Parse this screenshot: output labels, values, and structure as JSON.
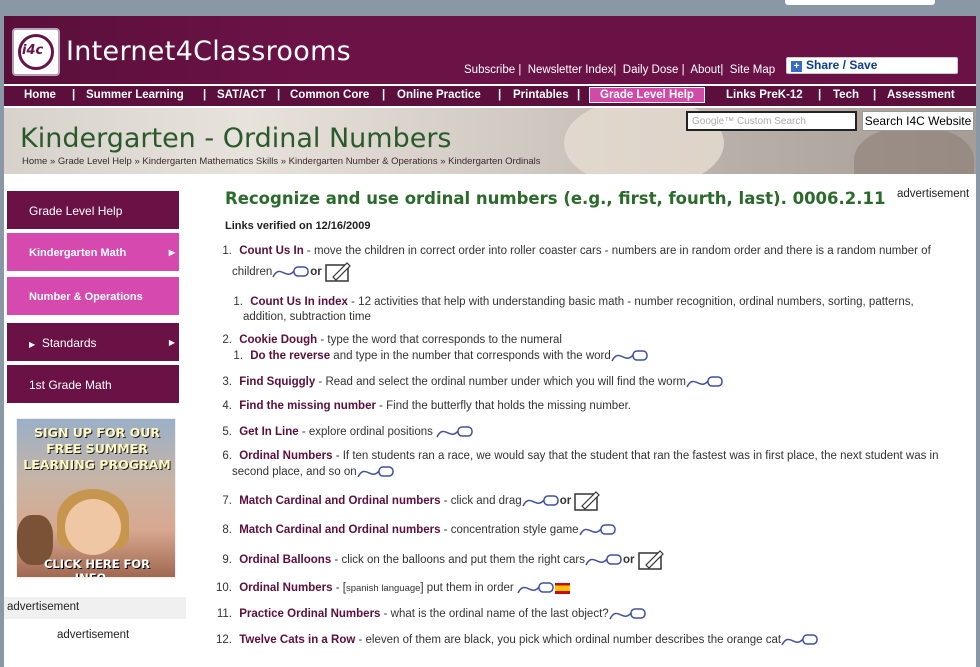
{
  "site": {
    "logo_mark": "i4c",
    "logo_text": "Internet4Classrooms"
  },
  "toplinks": [
    "Subscribe",
    "Newsletter Index",
    "Daily Dose",
    "About",
    "Site Map"
  ],
  "share_label": "Share / Save",
  "nav": [
    "Home",
    "Summer Learning",
    "SAT/ACT",
    "Common Core",
    "Online Practice",
    "Printables",
    "Grade Level Help",
    "Links PreK-12",
    "Tech",
    "Assessment"
  ],
  "nav_active": "Grade Level Help",
  "banner": {
    "title": "Kindergarten - Ordinal Numbers",
    "search_placeholder": "Google™ Custom Search",
    "search_button": "Search I4C Website",
    "breadcrumb": "Home » Grade Level Help » Kindergarten Mathematics Skills » Kindergarten Number & Operations » Kindergarten Ordinals"
  },
  "sidebar": {
    "items": [
      "Grade Level Help",
      "Kindergarten Math",
      "Number & Operations",
      "Standards",
      "1st Grade Math"
    ],
    "promo_lines": [
      "SIGN UP FOR OUR",
      "FREE SUMMER",
      "LEARNING PROGRAM"
    ],
    "promo_click": "CLICK HERE FOR INFO...",
    "ad_label": "advertisement",
    "ad_label2": "advertisement"
  },
  "main": {
    "heading": "Recognize and use ordinal numbers (e.g., first, fourth, last). 0006.2.11",
    "ad_label": "advertisement",
    "verified": "Links verified on 12/16/2009",
    "items": [
      {
        "num": "1.",
        "title": "Count Us In",
        "desc": " - move the children in correct order into roller coaster cars - numbers are in random order and there is a random number of",
        "cont": "children",
        "or": "or"
      },
      {
        "num": "1.",
        "title": "Count Us In index",
        "desc": " - 12 activities that help with understanding basic math - number recognition, ordinal numbers, sorting, patterns,",
        "cont": "addition, subtraction time"
      },
      {
        "num": "2.",
        "title": "Cookie Dough",
        "desc": " - type the word that corresponds to the numeral"
      },
      {
        "num": "1.",
        "title": "Do the reverse",
        "desc": " and type in the number that corresponds with the word"
      },
      {
        "num": "3.",
        "title": "Find Squiggly",
        "desc": " - Read and select the ordinal number under which you will find the worm"
      },
      {
        "num": "4.",
        "title": "Find the missing number",
        "desc": " - Find the butterfly that holds the missing number."
      },
      {
        "num": "5.",
        "title": "Get In Line",
        "desc": " - explore ordinal positions"
      },
      {
        "num": "6.",
        "title": "Ordinal Numbers",
        "desc": " - If ten students ran a race, we would say that the student that ran the fastest was in first place, the next student was in",
        "cont": "second place, and so on"
      },
      {
        "num": "7.",
        "title": "Match Cardinal and Ordinal numbers",
        "desc": " - click and drag",
        "or": "or"
      },
      {
        "num": "8.",
        "title": "Match Cardinal and Ordinal numbers",
        "desc": " - concentration style game"
      },
      {
        "num": "9.",
        "title": "Ordinal Balloons",
        "desc": " - click on the balloons and put them the right cars",
        "or": "or"
      },
      {
        "num": "10.",
        "title": "Ordinal Numbers",
        "desc_pre": " - [",
        "lang": "spanish language",
        "desc": "] put them in order"
      },
      {
        "num": "11.",
        "title": "Practice Ordinal Numbers",
        "desc": " - what is the ordinal name of the last object?"
      },
      {
        "num": "12.",
        "title": "Twelve Cats in a Row",
        "desc": " - eleven of them are black, you pick which ordinal number describes the orange cat"
      }
    ]
  }
}
